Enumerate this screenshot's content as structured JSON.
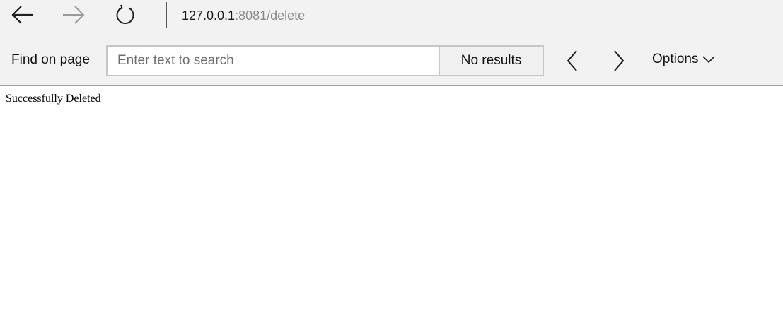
{
  "browser": {
    "icons": {
      "back": "arrow-left-icon",
      "forward": "arrow-right-icon",
      "refresh": "refresh-icon"
    },
    "forward_enabled": false,
    "url": {
      "host": "127.0.0.1",
      "rest": ":8081/delete"
    }
  },
  "findbar": {
    "label": "Find on page",
    "placeholder": "Enter text to search",
    "value": "",
    "results": "No results",
    "icons": {
      "previous": "chevron-left-icon",
      "next": "chevron-right-icon",
      "options": "chevron-down-icon"
    },
    "options_label": "Options"
  },
  "page": {
    "message": "Successfully Deleted"
  },
  "colors": {
    "chrome_background": "#f2f2f2",
    "disabled_icon": "#9a9a9a",
    "url_path": "#8a8a8a"
  }
}
